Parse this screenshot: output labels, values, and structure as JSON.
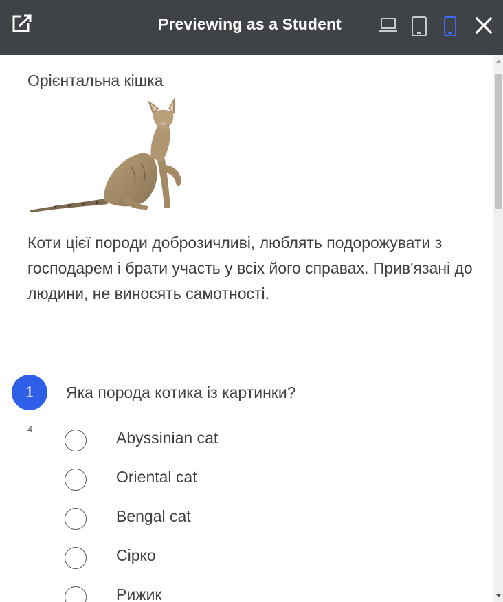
{
  "topbar": {
    "title": "Previewing as a Student",
    "icons": {
      "open": "open-in-new-icon",
      "laptop": "laptop-icon",
      "tablet": "tablet-icon",
      "phone": "phone-icon",
      "close": "close-icon"
    },
    "active_device": "phone",
    "colors": {
      "bar": "#3f4246",
      "active": "#3b6bf0",
      "inactive": "#c9cacc"
    }
  },
  "content": {
    "heading": "Орієнтальна кішка",
    "image": "oriental-cat-photo",
    "description": "Коти цієї породи доброзичливі, люблять подорожувати з господарем і брати участь у всіх його справах. Прив'язані до людини, не виносять самотності.",
    "question": {
      "number": "1",
      "text": "Яка порода котика із картинки?",
      "points": "4",
      "options": [
        "Abyssinian cat",
        "Oriental cat",
        "Bengal cat",
        "Сірко",
        "Рижик"
      ]
    }
  },
  "colors": {
    "accent": "#2f5fe9"
  }
}
